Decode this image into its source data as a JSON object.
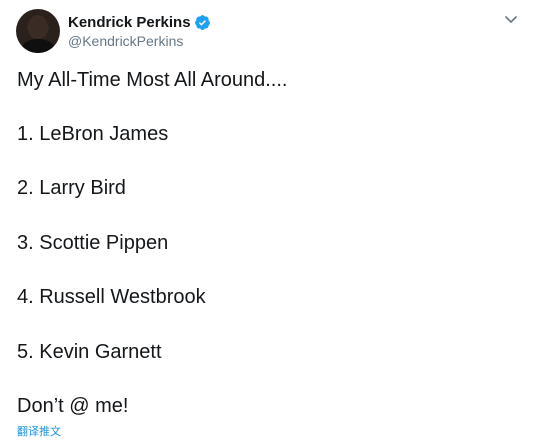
{
  "author": {
    "display_name": "Kendrick Perkins",
    "handle": "@KendrickPerkins",
    "verified_icon": "verified-badge-icon",
    "avatar_icon": "profile-avatar"
  },
  "menu": {
    "icon": "chevron-down-icon"
  },
  "tweet": {
    "lines": [
      "My All-Time Most All Around....",
      "1. LeBron James",
      "2. Larry Bird",
      "3. Scottie Pippen",
      "4. Russell Westbrook",
      "5. Kevin Garnett",
      "Don’t @ me!"
    ]
  },
  "translate_label": "翻译推文",
  "colors": {
    "text": "#14171a",
    "secondary_text": "#657786",
    "link": "#1b95e0",
    "verified": "#1da1f2"
  }
}
